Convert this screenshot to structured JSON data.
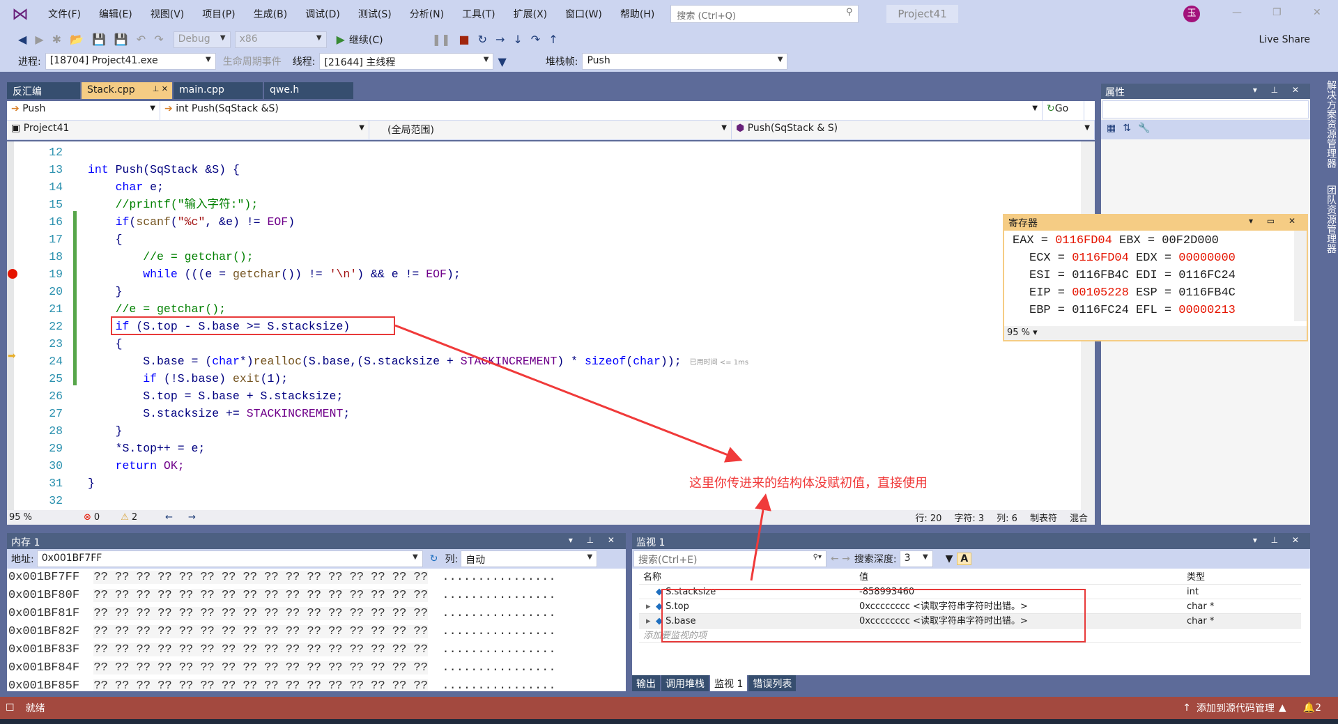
{
  "menu": {
    "items": [
      "文件(F)",
      "编辑(E)",
      "视图(V)",
      "项目(P)",
      "生成(B)",
      "调试(D)",
      "测试(S)",
      "分析(N)",
      "工具(T)",
      "扩展(X)",
      "窗口(W)",
      "帮助(H)"
    ],
    "search_placeholder": "搜索 (Ctrl+Q)",
    "project_title": "Project41",
    "avatar": "玉"
  },
  "toolbar": {
    "config": "Debug",
    "platform": "x86",
    "continue": "继续(C)",
    "live_share": "Live Share"
  },
  "debugbar": {
    "process_label": "进程:",
    "process": "[18704] Project41.exe",
    "lifecycle": "生命周期事件",
    "thread_label": "线程:",
    "thread": "[21644] 主线程",
    "stackframe_label": "堆栈帧:",
    "stackframe": "Push"
  },
  "doc_tabs": [
    {
      "label": "反汇编"
    },
    {
      "label": "Stack.cpp",
      "active": true
    },
    {
      "label": "main.cpp"
    },
    {
      "label": "qwe.h"
    }
  ],
  "nav": {
    "scope1": "Push",
    "func": "int Push(SqStack &S)",
    "go": "Go",
    "project": "Project41",
    "scope": "(全局范围)",
    "member": "Push(SqStack & S)"
  },
  "code": [
    {
      "n": "12",
      "t": []
    },
    {
      "n": "13",
      "t": [
        [
          "int",
          "kw"
        ],
        [
          " Push(SqStack &S) {",
          "tx"
        ]
      ]
    },
    {
      "n": "14",
      "t": [
        [
          "    "
        ],
        [
          "char",
          "kw"
        ],
        [
          " e;",
          "tx"
        ]
      ]
    },
    {
      "n": "15",
      "t": [
        [
          "    "
        ],
        [
          "//printf(\"输入字符:\");",
          "cm"
        ]
      ]
    },
    {
      "n": "16",
      "t": [
        [
          "    "
        ],
        [
          "if",
          "kw"
        ],
        [
          "(",
          "tx"
        ],
        [
          "scanf",
          "fn"
        ],
        [
          "(",
          "tx"
        ],
        [
          "\"%c\"",
          "st"
        ],
        [
          ", &e) != ",
          "tx"
        ],
        [
          "EOF",
          "mac"
        ],
        [
          ")",
          "tx"
        ]
      ]
    },
    {
      "n": "17",
      "t": [
        [
          "    {",
          "tx"
        ]
      ]
    },
    {
      "n": "18",
      "t": [
        [
          "        "
        ],
        [
          "//e = getchar();",
          "cm"
        ]
      ]
    },
    {
      "n": "19",
      "t": [
        [
          "        "
        ],
        [
          "while",
          "kw"
        ],
        [
          " (((e = ",
          "tx"
        ],
        [
          "getchar",
          "fn"
        ],
        [
          "()) != ",
          "tx"
        ],
        [
          "'\\n'",
          "st"
        ],
        [
          ") && e != ",
          "tx"
        ],
        [
          "EOF",
          "mac"
        ],
        [
          ");",
          "tx"
        ]
      ]
    },
    {
      "n": "20",
      "t": [
        [
          "    }",
          "tx"
        ]
      ]
    },
    {
      "n": "21",
      "t": [
        [
          "    "
        ],
        [
          "//e = getchar();",
          "cm"
        ]
      ]
    },
    {
      "n": "22",
      "t": [
        [
          "    "
        ],
        [
          "if",
          "kw"
        ],
        [
          " (S.top - S.base >= S.stacksize)",
          "tx"
        ]
      ]
    },
    {
      "n": "23",
      "t": [
        [
          "    {",
          "tx"
        ]
      ]
    },
    {
      "n": "24",
      "t": [
        [
          "        S.base = (",
          "tx"
        ],
        [
          "char",
          "kw"
        ],
        [
          "*)",
          "tx"
        ],
        [
          "realloc",
          "fn"
        ],
        [
          "(S.base,(S.stacksize + ",
          "tx"
        ],
        [
          "STACKINCREMENT",
          "mac"
        ],
        [
          ") * ",
          "tx"
        ],
        [
          "sizeof",
          "kw"
        ],
        [
          "(",
          "tx"
        ],
        [
          "char",
          "kw"
        ],
        [
          "));",
          "tx"
        ]
      ],
      "hint": "已用时间 <= 1ms"
    },
    {
      "n": "25",
      "t": [
        [
          "        "
        ],
        [
          "if",
          "kw"
        ],
        [
          " (!S.base) ",
          "tx"
        ],
        [
          "exit",
          "fn"
        ],
        [
          "(1);",
          "tx"
        ]
      ]
    },
    {
      "n": "26",
      "t": [
        [
          "        S.top = S.base + S.stacksize;",
          "tx"
        ]
      ]
    },
    {
      "n": "27",
      "t": [
        [
          "        S.stacksize += ",
          "tx"
        ],
        [
          "STACKINCREMENT",
          "mac"
        ],
        [
          ";",
          "tx"
        ]
      ]
    },
    {
      "n": "28",
      "t": [
        [
          "    }",
          "tx"
        ]
      ]
    },
    {
      "n": "29",
      "t": [
        [
          "    *S.top++ = e;",
          "tx"
        ]
      ]
    },
    {
      "n": "30",
      "t": [
        [
          "    "
        ],
        [
          "return",
          "kw"
        ],
        [
          " OK;",
          "mac"
        ]
      ]
    },
    {
      "n": "31",
      "t": [
        [
          "}",
          "tx"
        ]
      ]
    },
    {
      "n": "32",
      "t": []
    }
  ],
  "editor_status": {
    "zoom": "95 %",
    "errors": "0",
    "warnings": "2",
    "line": "行: 20",
    "char": "字符: 3",
    "col": "列: 6",
    "tabs": "制表符",
    "eol": "混合"
  },
  "annotation": "这里你传进来的结构体没赋初值，直接使用",
  "properties": {
    "title": "属性"
  },
  "side_tabs": [
    "解决方案资源管理器",
    "团队资源管理器"
  ],
  "registers": {
    "title": "寄存器",
    "zoom": "95 %",
    "rows": [
      [
        [
          "EAX",
          "0116FD04",
          true
        ],
        [
          "EBX",
          "00F2D000",
          false
        ]
      ],
      [
        [
          "ECX",
          "0116FD04",
          true
        ],
        [
          "EDX",
          "00000000",
          true
        ]
      ],
      [
        [
          "ESI",
          "0116FB4C",
          false
        ],
        [
          "EDI",
          "0116FC24",
          false
        ]
      ],
      [
        [
          "EIP",
          "00105228",
          true
        ],
        [
          "ESP",
          "0116FB4C",
          false
        ]
      ],
      [
        [
          "EBP",
          "0116FC24",
          false
        ],
        [
          "EFL",
          "00000213",
          true
        ]
      ]
    ]
  },
  "memory": {
    "title": "内存 1",
    "addr_label": "地址:",
    "addr": "0x001BF7FF",
    "col_label": "列:",
    "col": "自动",
    "rows": [
      {
        "a": "0x001BF7FF"
      },
      {
        "a": "0x001BF80F"
      },
      {
        "a": "0x001BF81F"
      },
      {
        "a": "0x001BF82F"
      },
      {
        "a": "0x001BF83F"
      },
      {
        "a": "0x001BF84F"
      },
      {
        "a": "0x001BF85F"
      }
    ],
    "bytes": "?? ?? ?? ?? ?? ?? ?? ?? ?? ?? ?? ?? ?? ?? ?? ??",
    "ascii": "................"
  },
  "watch": {
    "title": "监视 1",
    "search_placeholder": "搜索(Ctrl+E)",
    "depth_label": "搜索深度:",
    "depth": "3",
    "headers": [
      "名称",
      "值",
      "类型"
    ],
    "rows": [
      {
        "name": "S.stacksize",
        "value": "-858993460",
        "type": "int"
      },
      {
        "name": "S.top",
        "value": "0xcccccccc <读取字符串字符时出错。>",
        "type": "char *"
      },
      {
        "name": "S.base",
        "value": "0xcccccccc <读取字符串字符时出错。>",
        "type": "char *"
      }
    ],
    "add_placeholder": "添加要监视的项"
  },
  "bottom_tabs": [
    "输出",
    "调用堆栈",
    "监视 1",
    "错误列表"
  ],
  "status": {
    "ready": "就绪",
    "source_control": "添加到源代码管理",
    "notifications": "2"
  }
}
